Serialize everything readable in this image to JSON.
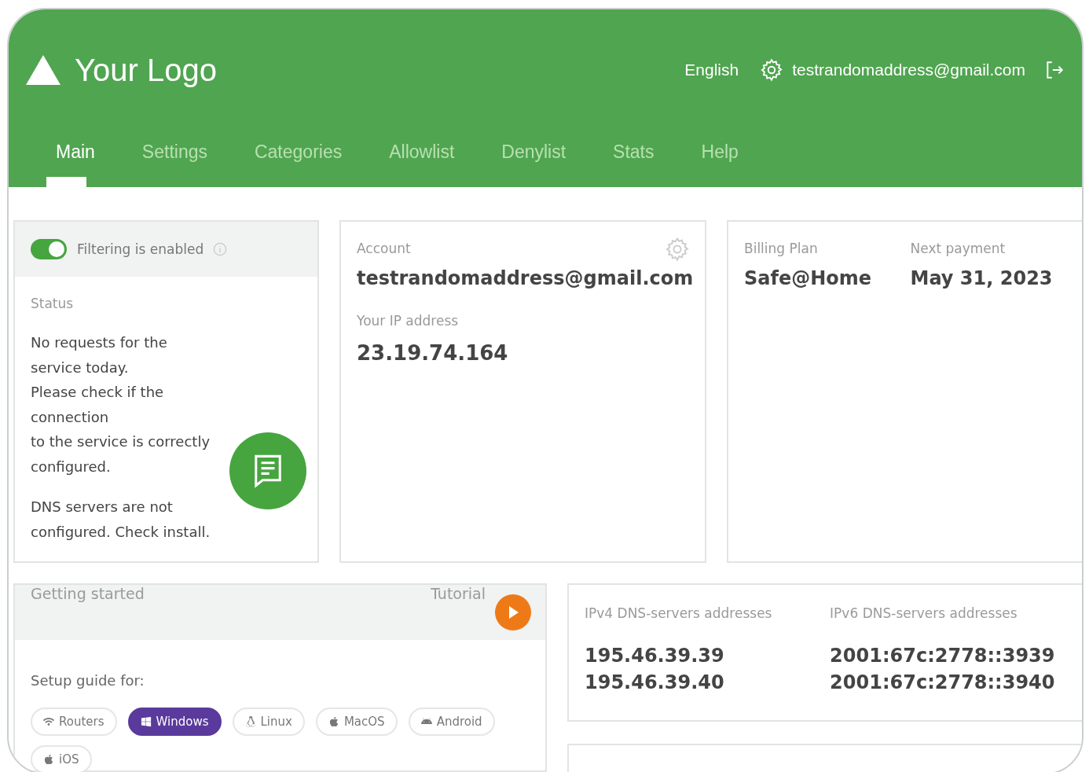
{
  "header": {
    "logo": "Your Logo",
    "language": "English",
    "user_email": "testrandomaddress@gmail.com"
  },
  "tabs": [
    {
      "label": "Main",
      "selected": true
    },
    {
      "label": "Settings",
      "selected": false
    },
    {
      "label": "Categories",
      "selected": false
    },
    {
      "label": "Allowlist",
      "selected": false
    },
    {
      "label": "Denylist",
      "selected": false
    },
    {
      "label": "Stats",
      "selected": false
    },
    {
      "label": "Help",
      "selected": false
    }
  ],
  "filtering": {
    "label": "Filtering is enabled",
    "on": true
  },
  "status": {
    "title": "Status",
    "paragraphs": [
      [
        "No requests for the",
        "service today.",
        "Please check if the",
        "connection",
        "to the service is correctly",
        "configured."
      ],
      [
        "DNS servers are not",
        "configured. Check install."
      ]
    ]
  },
  "account": {
    "title": "Account",
    "email": "testrandomaddress@gmail.com",
    "ip_label": "Your IP address",
    "ip": "23.19.74.164"
  },
  "billing": {
    "plan_label": "Billing Plan",
    "plan": "Safe@Home",
    "next_label": "Next payment",
    "next": "May 31, 2023"
  },
  "getting_started": {
    "title": "Getting started",
    "tutorial": "Tutorial",
    "setup_label": "Setup guide for:",
    "platforms": [
      {
        "label": "Routers",
        "kind": "wifi",
        "selected": false
      },
      {
        "label": "Windows",
        "kind": "windows",
        "selected": true
      },
      {
        "label": "Linux",
        "kind": "linux",
        "selected": false
      },
      {
        "label": "MacOS",
        "kind": "apple",
        "selected": false
      },
      {
        "label": "Android",
        "kind": "android",
        "selected": false
      },
      {
        "label": "iOS",
        "kind": "apple",
        "selected": false
      }
    ]
  },
  "dns": {
    "ipv4_label": "IPv4 DNS-servers addresses",
    "ipv4": [
      "195.46.39.39",
      "195.46.39.40"
    ],
    "ipv6_label": "IPv6 DNS-servers addresses",
    "ipv6": [
      "2001:67c:2778::3939",
      "2001:67c:2778::3940"
    ]
  }
}
